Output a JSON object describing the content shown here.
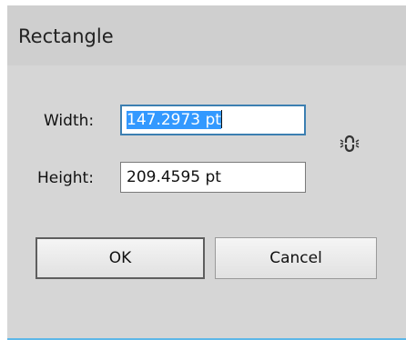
{
  "dialog": {
    "title": "Rectangle",
    "width_label": "Width:",
    "width_value_selected": "147.2973 pt",
    "height_label": "Height:",
    "height_value": "209.4595 pt",
    "constrain_icon": "link-proportions-icon",
    "ok_label": "OK",
    "cancel_label": "Cancel"
  },
  "colors": {
    "dialog_bg": "#d6d6d6",
    "selection": "#3399ff",
    "focus_border": "#3c7fb1",
    "bottom_accent": "#5db7e8"
  }
}
